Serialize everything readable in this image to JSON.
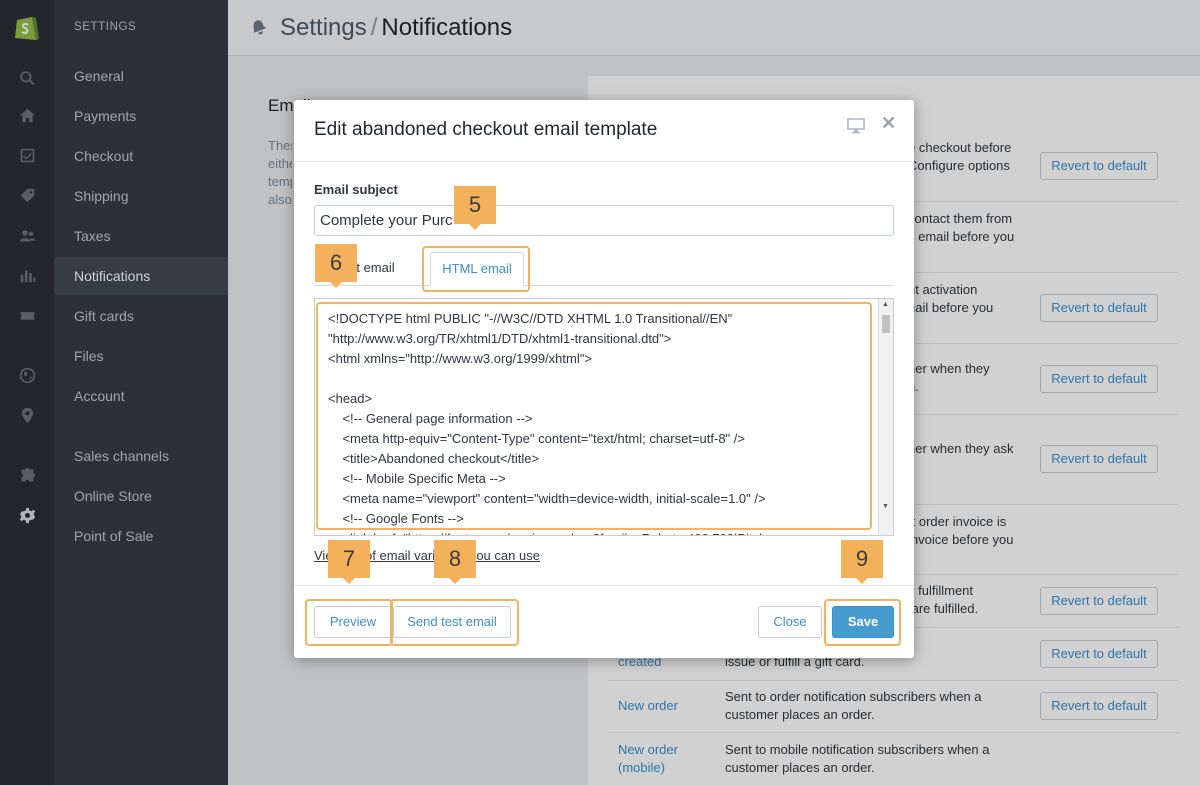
{
  "sidebar": {
    "section_title": "SETTINGS",
    "items": [
      {
        "label": "General"
      },
      {
        "label": "Payments"
      },
      {
        "label": "Checkout"
      },
      {
        "label": "Shipping"
      },
      {
        "label": "Taxes"
      },
      {
        "label": "Notifications",
        "active": true
      },
      {
        "label": "Gift cards"
      },
      {
        "label": "Files"
      },
      {
        "label": "Account"
      },
      {
        "label": "Sales channels"
      },
      {
        "label": "Online Store"
      },
      {
        "label": "Point of Sale"
      }
    ]
  },
  "rail_icons": [
    "shopify-logo-icon",
    "search-icon",
    "home-icon",
    "orders-icon",
    "tag-icon",
    "customers-icon",
    "reports-icon",
    "discounts-icon",
    "globe-icon",
    "location-icon",
    "apps-icon",
    "gear-icon"
  ],
  "header": {
    "breadcrumb_parent": "Settings",
    "separator": "/",
    "breadcrumb_current": "Notifications"
  },
  "page": {
    "section_title": "Email",
    "section_desc_lines": [
      "These",
      "eithe",
      "temp",
      "also"
    ],
    "rows": [
      {
        "name": "",
        "desc": "e checkout before\nConfigure options",
        "revert": "Revert to default"
      },
      {
        "name": "",
        "desc": "contact them from\ns email before you",
        "revert": ""
      },
      {
        "name": "",
        "desc": "nt activation\nnail before you",
        "revert": "Revert to default"
      },
      {
        "name": "",
        "desc": "ner when they\nn.",
        "revert": "Revert to default"
      },
      {
        "name": "",
        "desc": "ner when they ask\nl.",
        "revert": "Revert to default"
      },
      {
        "name": "",
        "desc": "ft order invoice is\ninvoice before you",
        "revert": ""
      },
      {
        "name": "",
        "desc": "y fulfillment\n are fulfilled.",
        "revert": "Revert to default"
      },
      {
        "name": "created",
        "desc": "ner when you\nissue or fulfill a gift card.",
        "revert": "Revert to default"
      },
      {
        "name": "New order",
        "desc": "Sent to order notification subscribers when a\ncustomer places an order.",
        "revert": "Revert to default"
      },
      {
        "name": "New order\n(mobile)",
        "desc": "Sent to mobile notification subscribers when a\ncustomer places an order.",
        "revert": ""
      }
    ]
  },
  "modal": {
    "title": "Edit abandoned checkout email template",
    "subject_label": "Email subject",
    "subject_value": "Complete your Purc",
    "tab_plain": "text email",
    "tab_html": "HTML email",
    "code": "<!DOCTYPE html PUBLIC \"-//W3C//DTD XHTML 1.0 Transitional//EN\"\n\"http://www.w3.org/TR/xhtml1/DTD/xhtml1-transitional.dtd\">\n<html xmlns=\"http://www.w3.org/1999/xhtml\">\n\n<head>\n    <!-- General page information -->\n    <meta http-equiv=\"Content-Type\" content=\"text/html; charset=utf-8\" />\n    <title>Abandoned checkout</title>\n    <!-- Mobile Specific Meta -->\n    <meta name=\"viewport\" content=\"width=device-width, initial-scale=1.0\" />\n    <!-- Google Fonts -->\n    <link href=\"https://fonts.googleapis.com/css?family=Roboto:400,700|Pitch",
    "vars_link": "View list of email variables you can use",
    "preview_button": "Preview",
    "send_test_button": "Send test email",
    "close_button": "Close",
    "save_button": "Save"
  },
  "annotations": [
    "5",
    "6",
    "7",
    "8",
    "9"
  ],
  "colors": {
    "accent": "#3a8fd0",
    "save": "#479ccf",
    "callout": "#f3b15c"
  }
}
